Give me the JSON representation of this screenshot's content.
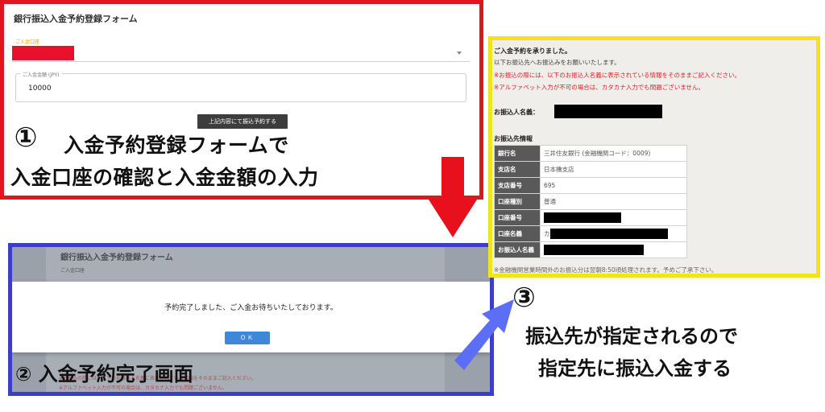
{
  "panel1": {
    "form_title": "銀行振込入金予約登録フォーム",
    "account_label": "ご入金口座",
    "amount_label": "ご入金金額 (JPY)",
    "amount_value": "10000",
    "submit_label": "上記内容にて振込予約する",
    "step_number": "①",
    "caption_line1": "入金予約登録フォームで",
    "caption_line2": "入金口座の確認と入金金額の入力",
    "border_color": "#e0161e"
  },
  "panel2": {
    "bg_form_title": "銀行振込入金予約登録フォーム",
    "bg_account_label": "ご入金口座",
    "modal_message": "予約完了しました、ご入金お待ちいたしております。",
    "ok_label": "ＯＫ",
    "bg_note1": "※お振込の際には、以下のお振込人名義に表示されている情報をそのままご記入ください。",
    "bg_note2": "※アルファベット入力が不可の場合は、カタカナ入力でも問題ございません。",
    "caption": "② 入金予約完了画面",
    "border_color": "#3b3fc8"
  },
  "panel3": {
    "thanks": "ご入金予約を承りました。",
    "instruction": "以下お振込先へお振込みをお願いいたします。",
    "note1": "※お振込の際には、以下のお振込人名義に表示されている情報をそのままご記入ください。",
    "note2": "※アルファベット入力が不可の場合は、カタカナ入力でも問題ございません。",
    "payer_label": "お振込人名義：",
    "dest_title": "お振込先情報",
    "rows": [
      {
        "label": "銀行名",
        "value": "三井住友銀行 (金融機関コード：0009)"
      },
      {
        "label": "支店名",
        "value": "日本橋支店"
      },
      {
        "label": "支店番号",
        "value": "695"
      },
      {
        "label": "口座種別",
        "value": "普通"
      },
      {
        "label": "口座番号",
        "value": ""
      },
      {
        "label": "口座名義",
        "value": "カ"
      },
      {
        "label": "お振込人名義",
        "value": ""
      }
    ],
    "footer": "※金融機関営業時間外のお振込分は翌朝8:50頃処理されます。予めご了承下さい。",
    "border_color": "#f4e21a"
  },
  "step3": {
    "number": "③",
    "caption_line1": "振込先が指定されるので",
    "caption_line2": "指定先に振込入金する"
  },
  "arrows": {
    "down_color": "#e8101c",
    "up_color": "#5b6ef5"
  }
}
